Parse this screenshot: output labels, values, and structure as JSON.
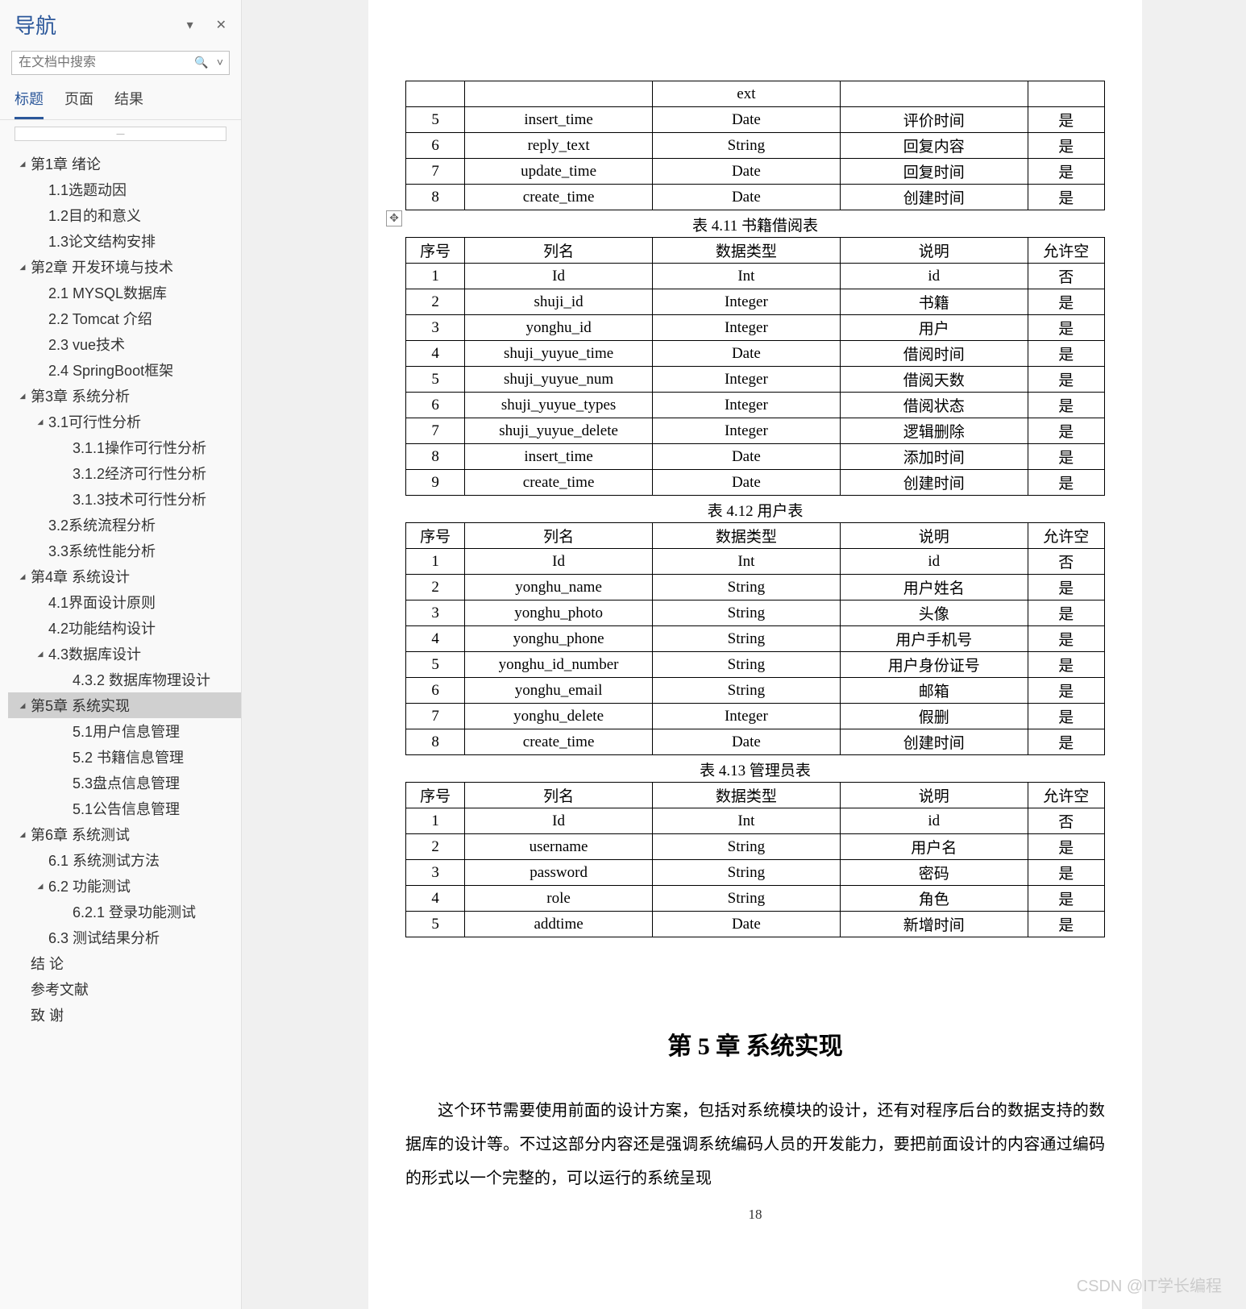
{
  "nav": {
    "title": "导航",
    "search_placeholder": "在文档中搜索",
    "tabs": [
      "标题",
      "页面",
      "结果"
    ],
    "tree": [
      {
        "lvl": 0,
        "caret": "▲",
        "text": "第1章 绪论"
      },
      {
        "lvl": 1,
        "caret": "",
        "text": "1.1选题动因"
      },
      {
        "lvl": 1,
        "caret": "",
        "text": "1.2目的和意义"
      },
      {
        "lvl": 1,
        "caret": "",
        "text": "1.3论文结构安排"
      },
      {
        "lvl": 0,
        "caret": "▲",
        "text": "第2章 开发环境与技术"
      },
      {
        "lvl": 1,
        "caret": "",
        "text": "2.1 MYSQL数据库"
      },
      {
        "lvl": 1,
        "caret": "",
        "text": "2.2 Tomcat 介绍"
      },
      {
        "lvl": 1,
        "caret": "",
        "text": "2.3 vue技术"
      },
      {
        "lvl": 1,
        "caret": "",
        "text": "2.4 SpringBoot框架"
      },
      {
        "lvl": 0,
        "caret": "▲",
        "text": "第3章 系统分析"
      },
      {
        "lvl": 1,
        "caret": "▲",
        "text": "3.1可行性分析"
      },
      {
        "lvl": 2,
        "caret": "",
        "text": "3.1.1操作可行性分析"
      },
      {
        "lvl": 2,
        "caret": "",
        "text": "3.1.2经济可行性分析"
      },
      {
        "lvl": 2,
        "caret": "",
        "text": "3.1.3技术可行性分析"
      },
      {
        "lvl": 1,
        "caret": "",
        "text": "3.2系统流程分析"
      },
      {
        "lvl": 1,
        "caret": "",
        "text": "3.3系统性能分析"
      },
      {
        "lvl": 0,
        "caret": "▲",
        "text": "第4章 系统设计"
      },
      {
        "lvl": 1,
        "caret": "",
        "text": "4.1界面设计原则"
      },
      {
        "lvl": 1,
        "caret": "",
        "text": "4.2功能结构设计"
      },
      {
        "lvl": 1,
        "caret": "▲",
        "text": "4.3数据库设计"
      },
      {
        "lvl": 2,
        "caret": "",
        "text": "4.3.2 数据库物理设计"
      },
      {
        "lvl": 0,
        "caret": "▲",
        "text": "第5章 系统实现",
        "selected": true
      },
      {
        "lvl": 2,
        "caret": "",
        "text": "5.1用户信息管理"
      },
      {
        "lvl": 2,
        "caret": "",
        "text": "5.2 书籍信息管理"
      },
      {
        "lvl": 2,
        "caret": "",
        "text": "5.3盘点信息管理"
      },
      {
        "lvl": 2,
        "caret": "",
        "text": "5.1公告信息管理"
      },
      {
        "lvl": 0,
        "caret": "▲",
        "text": "第6章 系统测试"
      },
      {
        "lvl": 1,
        "caret": "",
        "text": "6.1 系统测试方法"
      },
      {
        "lvl": 1,
        "caret": "▲",
        "text": "6.2 功能测试"
      },
      {
        "lvl": 2,
        "caret": "",
        "text": "6.2.1 登录功能测试"
      },
      {
        "lvl": 1,
        "caret": "",
        "text": "6.3 测试结果分析"
      },
      {
        "lvl": 0,
        "caret": "",
        "text": "结  论"
      },
      {
        "lvl": 0,
        "caret": "",
        "text": "参考文献"
      },
      {
        "lvl": 0,
        "caret": "",
        "text": "致  谢"
      }
    ]
  },
  "doc": {
    "table_top_rows": [
      [
        "",
        "",
        "ext",
        "",
        ""
      ],
      [
        "5",
        "insert_time",
        "Date",
        "评价时间",
        "是"
      ],
      [
        "6",
        "reply_text",
        "String",
        "回复内容",
        "是"
      ],
      [
        "7",
        "update_time",
        "Date",
        "回复时间",
        "是"
      ],
      [
        "8",
        "create_time",
        "Date",
        "创建时间",
        "是"
      ]
    ],
    "caption_411": "表 4.11 书籍借阅表",
    "table_411": [
      [
        "序号",
        "列名",
        "数据类型",
        "说明",
        "允许空"
      ],
      [
        "1",
        "Id",
        "Int",
        "id",
        "否"
      ],
      [
        "2",
        "shuji_id",
        "Integer",
        "书籍",
        "是"
      ],
      [
        "3",
        "yonghu_id",
        "Integer",
        "用户",
        "是"
      ],
      [
        "4",
        "shuji_yuyue_time",
        "Date",
        "借阅时间",
        "是"
      ],
      [
        "5",
        "shuji_yuyue_num",
        "Integer",
        "借阅天数",
        "是"
      ],
      [
        "6",
        "shuji_yuyue_types",
        "Integer",
        "借阅状态",
        "是"
      ],
      [
        "7",
        "shuji_yuyue_delete",
        "Integer",
        "逻辑删除",
        "是"
      ],
      [
        "8",
        "insert_time",
        "Date",
        "添加时间",
        "是"
      ],
      [
        "9",
        "create_time",
        "Date",
        "创建时间",
        "是"
      ]
    ],
    "caption_412": "表 4.12 用户表",
    "table_412": [
      [
        "序号",
        "列名",
        "数据类型",
        "说明",
        "允许空"
      ],
      [
        "1",
        "Id",
        "Int",
        "id",
        "否"
      ],
      [
        "2",
        "yonghu_name",
        "String",
        "用户姓名",
        "是"
      ],
      [
        "3",
        "yonghu_photo",
        "String",
        "头像",
        "是"
      ],
      [
        "4",
        "yonghu_phone",
        "String",
        "用户手机号",
        "是"
      ],
      [
        "5",
        "yonghu_id_number",
        "String",
        "用户身份证号",
        "是"
      ],
      [
        "6",
        "yonghu_email",
        "String",
        "邮箱",
        "是"
      ],
      [
        "7",
        "yonghu_delete",
        "Integer",
        "假删",
        "是"
      ],
      [
        "8",
        "create_time",
        "Date",
        "创建时间",
        "是"
      ]
    ],
    "caption_413": "表 4.13 管理员表",
    "table_413": [
      [
        "序号",
        "列名",
        "数据类型",
        "说明",
        "允许空"
      ],
      [
        "1",
        "Id",
        "Int",
        "id",
        "否"
      ],
      [
        "2",
        "username",
        "String",
        "用户名",
        "是"
      ],
      [
        "3",
        "password",
        "String",
        "密码",
        "是"
      ],
      [
        "4",
        "role",
        "String",
        "角色",
        "是"
      ],
      [
        "5",
        "addtime",
        "Date",
        "新增时间",
        "是"
      ]
    ],
    "chapter_title": "第 5 章  系统实现",
    "body": "这个环节需要使用前面的设计方案，包括对系统模块的设计，还有对程序后台的数据支持的数据库的设计等。不过这部分内容还是强调系统编码人员的开发能力，要把前面设计的内容通过编码的形式以一个完整的，可以运行的系统呈现",
    "pagenum": "18",
    "watermark": "CSDN @IT学长编程"
  }
}
